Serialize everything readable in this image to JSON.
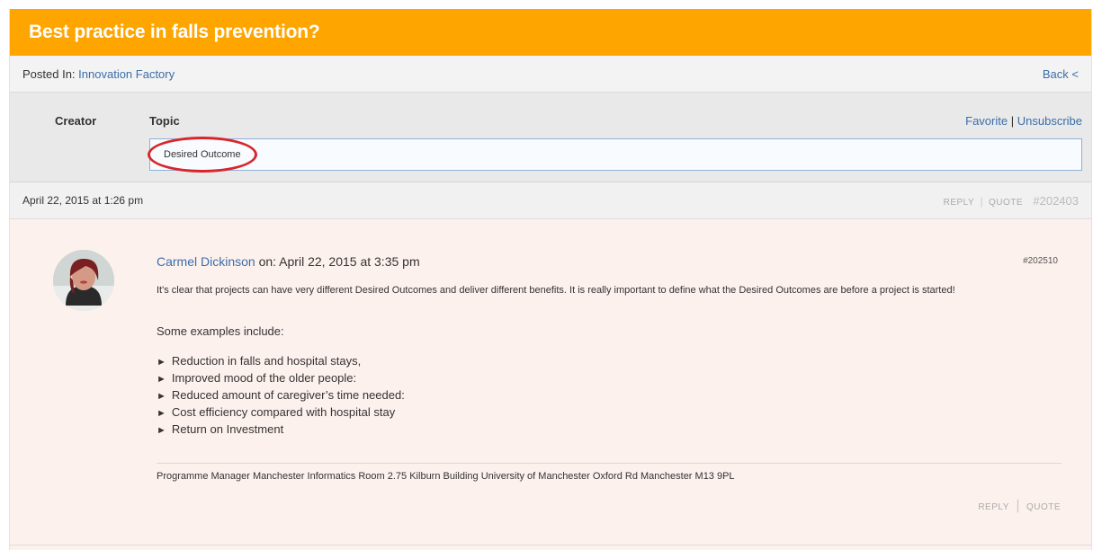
{
  "topic": {
    "title": "Best practice in falls prevention?",
    "posted_in_label": "Posted In:",
    "forum_name": "Innovation Factory",
    "back_label": "Back <"
  },
  "header": {
    "creator_label": "Creator",
    "topic_label": "Topic",
    "favorite_label": "Favorite",
    "divider": "|",
    "unsubscribe_label": "Unsubscribe",
    "topic_value": "Desired Outcome"
  },
  "first_post": {
    "date": "April 22, 2015 at 1:26 pm",
    "reply_label": "REPLY",
    "quote_label": "QUOTE",
    "post_id": "#202403"
  },
  "reply": {
    "author": "Carmel Dickinson",
    "on_date": "on: April 22, 2015 at 3:35 pm",
    "post_id": "#202510",
    "body": "It's clear that projects can have very different Desired Outcomes and deliver different benefits. It is really important to define what the Desired Outcomes are before a project is started!",
    "examples_intro": "Some examples include:",
    "bullets": [
      "Reduction in falls and hospital stays,",
      "Improved mood of the older people:",
      "Reduced amount of caregiver’s time needed:",
      "Cost efficiency compared with hospital stay",
      "Return on Investment"
    ],
    "signature": "Programme Manager Manchester Informatics Room 2.75 Kilburn Building University of Manchester Oxford Rd Manchester M13 9PL",
    "reply_label": "REPLY",
    "quote_label": "QUOTE"
  },
  "colors": {
    "title_bar": "#ffa500",
    "link": "#3b6ea8",
    "post_background": "#fdf1ee",
    "highlight_circle": "#d9262b"
  }
}
